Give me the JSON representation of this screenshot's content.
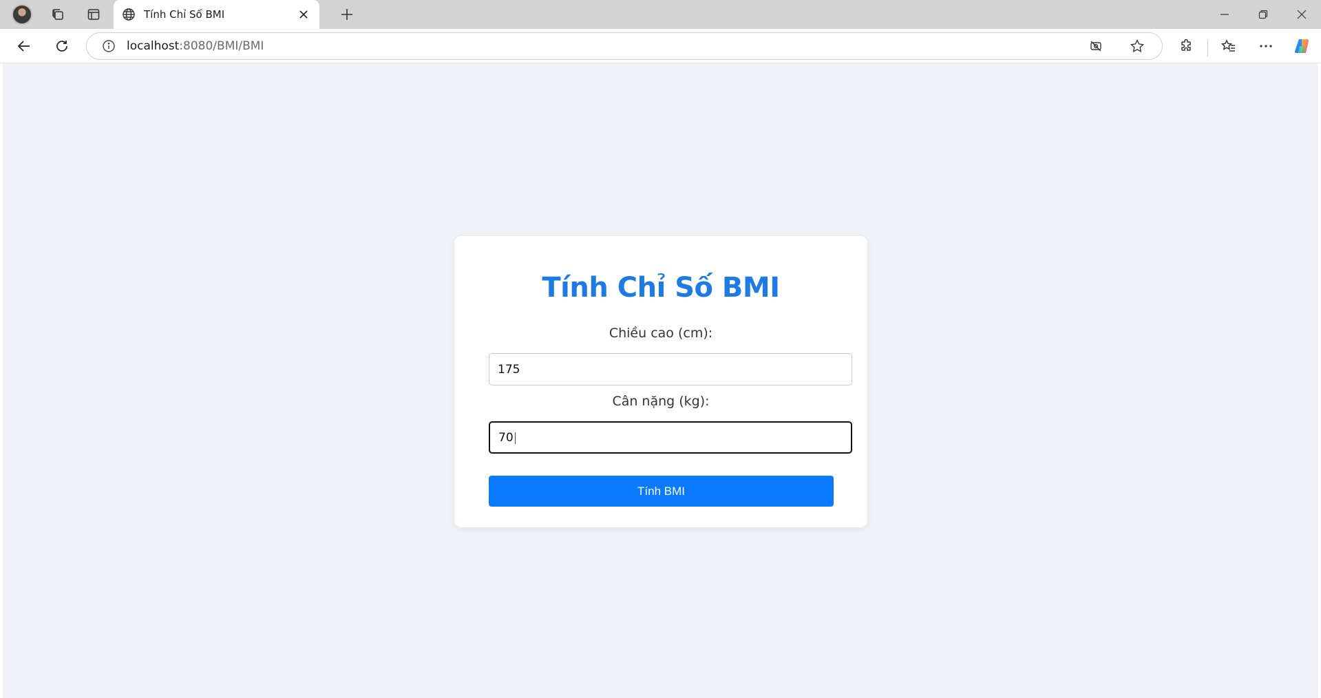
{
  "browser": {
    "tab_title": "Tính Chỉ Số BMI",
    "url_host": "localhost",
    "url_rest": ":8080/BMI/BMI"
  },
  "icons": {
    "tab_favicon": "globe-icon",
    "new_tab": "plus-icon",
    "back": "arrow-left-icon",
    "reload": "reload-icon",
    "site_info": "info-icon",
    "tracking": "eye-off-icon",
    "favorite": "star-icon",
    "extensions": "puzzle-icon",
    "favorites_list": "favorites-icon",
    "more": "more-horizontal-icon",
    "copilot": "copilot-icon"
  },
  "form": {
    "title": "Tính Chỉ Số BMI",
    "height_label": "Chiều cao (cm):",
    "height_value": "175",
    "weight_label": "Cân nặng (kg):",
    "weight_value": "70",
    "submit_label": "Tính BMI"
  },
  "colors": {
    "accent": "#1e7be6",
    "button": "#0a7bff",
    "page_bg": "#eff2f6"
  }
}
